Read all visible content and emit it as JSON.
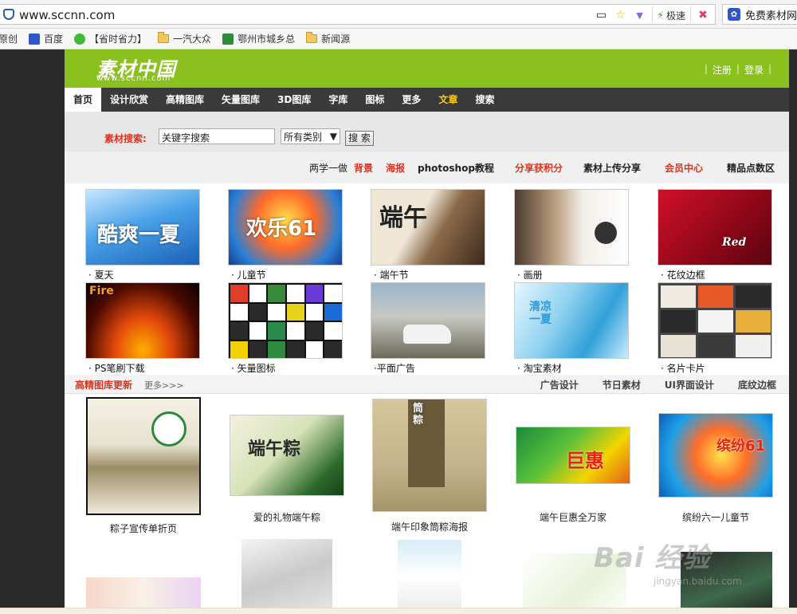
{
  "browser": {
    "url": "www.sccnn.com",
    "speed_label": "极速",
    "tab_title": "免费素材网",
    "favorites": [
      {
        "label": "原创",
        "icon": "none"
      },
      {
        "label": "百度",
        "icon": "baidu-paw-icon"
      },
      {
        "label": "【省时省力】",
        "icon": "wechat-icon"
      },
      {
        "label": "一汽大众",
        "icon": "folder-icon"
      },
      {
        "label": "鄂州市城乡总",
        "icon": "site-icon"
      },
      {
        "label": "新闻源",
        "icon": "folder-icon"
      }
    ]
  },
  "site": {
    "logo_cn": "素材中国",
    "logo_url": "www.sccnn.com",
    "register": "注册",
    "login": "登录",
    "brand_color": "#8bc11f",
    "nav": [
      {
        "label": "首页",
        "state": "active"
      },
      {
        "label": "设计欣赏",
        "state": "normal"
      },
      {
        "label": "高精图库",
        "state": "normal"
      },
      {
        "label": "矢量图库",
        "state": "normal"
      },
      {
        "label": "3D图库",
        "state": "normal"
      },
      {
        "label": "字库",
        "state": "normal"
      },
      {
        "label": "图标",
        "state": "normal"
      },
      {
        "label": "更多",
        "state": "normal"
      },
      {
        "label": "文章",
        "state": "hot"
      },
      {
        "label": "搜索",
        "state": "normal"
      }
    ],
    "search": {
      "label": "素材搜索:",
      "input_value": "关键字搜索",
      "select_value": "所有类别",
      "button": "搜 索"
    },
    "subnav": {
      "prefix": "两学一做",
      "links": [
        {
          "label": "背景",
          "color": "red"
        },
        {
          "label": "海报",
          "color": "red"
        },
        {
          "label": "photoshop教程",
          "color": "dark"
        },
        {
          "label": "分享获积分",
          "color": "red"
        },
        {
          "label": "素材上传分享",
          "color": "dark"
        },
        {
          "label": "会员中心",
          "color": "red"
        },
        {
          "label": "精品点数区",
          "color": "dark"
        }
      ]
    },
    "thumbs": [
      {
        "label": "· 夏天",
        "img_text": "酷爽一夏"
      },
      {
        "label": "· 儿童节",
        "img_text": "欢乐61"
      },
      {
        "label": "· 端午节",
        "img_text": "端午"
      },
      {
        "label": "· 画册",
        "img_text": ""
      },
      {
        "label": "· 花纹边框",
        "img_text": "Red"
      },
      {
        "label": "· PS笔刷下载",
        "img_text": "Fire"
      },
      {
        "label": "· 矢量图标",
        "img_text": ""
      },
      {
        "label": "·平面广告",
        "img_text": ""
      },
      {
        "label": "· 淘宝素材",
        "img_text": "清凉一夏"
      },
      {
        "label": "· 名片卡片",
        "img_text": ""
      }
    ],
    "section": {
      "title": "高精图库更新",
      "more": "更多>>>",
      "links": [
        "广告设计",
        "节日素材",
        "UI界面设计",
        "底纹边框"
      ]
    },
    "gallery": [
      {
        "caption": "粽子宣传单折页"
      },
      {
        "caption": "爱的礼物端午粽"
      },
      {
        "caption": "端午印象筒粽海报"
      },
      {
        "caption": "端午巨惠全万家"
      },
      {
        "caption": "缤纷六一儿童节"
      }
    ],
    "gallery_img_text": {
      "b2": "端午粽",
      "b3": "筒粽",
      "b4": "巨惠",
      "b5": "缤纷61"
    }
  },
  "watermark": {
    "text": "Bai 经验",
    "sub": "jingyan.baidu.com"
  }
}
